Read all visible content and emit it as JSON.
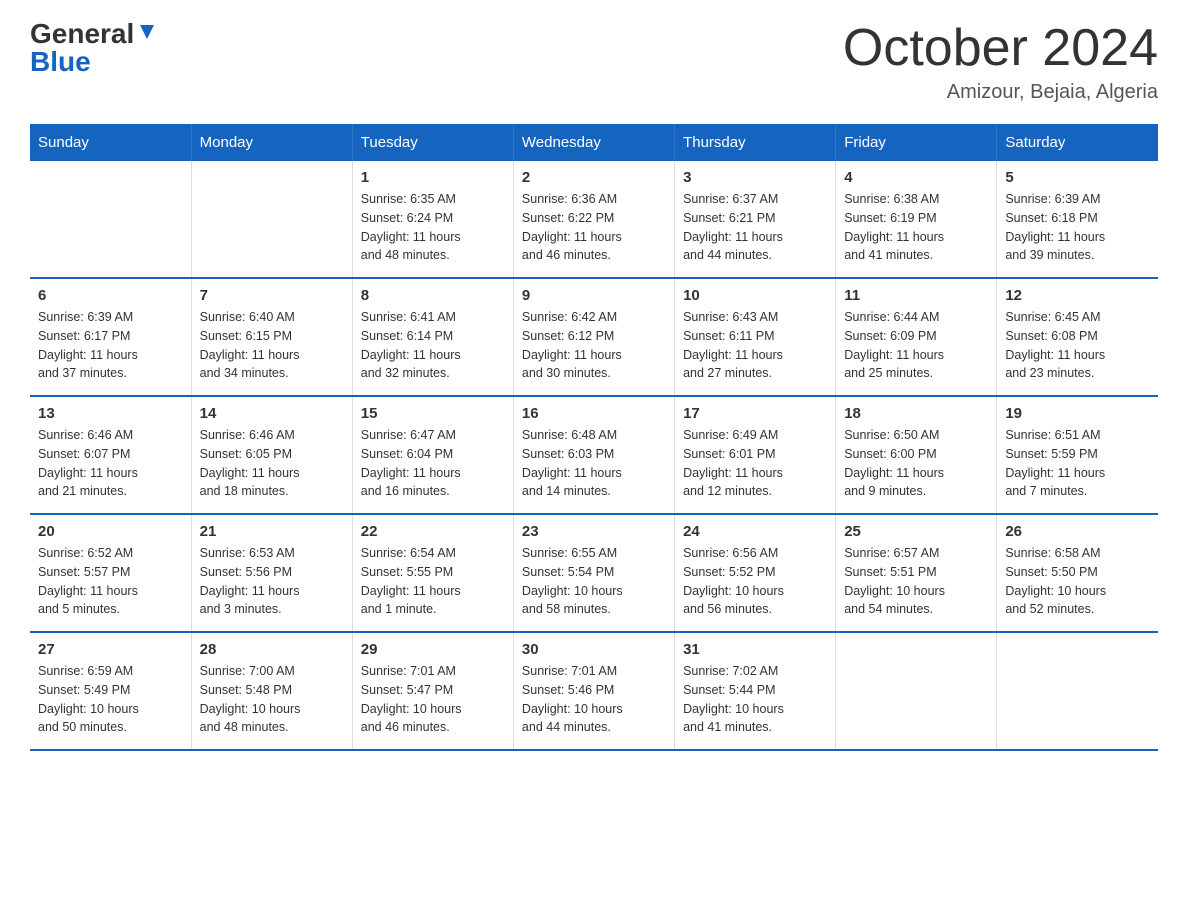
{
  "logo": {
    "general": "General",
    "blue": "Blue"
  },
  "title": "October 2024",
  "subtitle": "Amizour, Bejaia, Algeria",
  "days_of_week": [
    "Sunday",
    "Monday",
    "Tuesday",
    "Wednesday",
    "Thursday",
    "Friday",
    "Saturday"
  ],
  "weeks": [
    [
      {
        "day": "",
        "info": ""
      },
      {
        "day": "",
        "info": ""
      },
      {
        "day": "1",
        "info": "Sunrise: 6:35 AM\nSunset: 6:24 PM\nDaylight: 11 hours\nand 48 minutes."
      },
      {
        "day": "2",
        "info": "Sunrise: 6:36 AM\nSunset: 6:22 PM\nDaylight: 11 hours\nand 46 minutes."
      },
      {
        "day": "3",
        "info": "Sunrise: 6:37 AM\nSunset: 6:21 PM\nDaylight: 11 hours\nand 44 minutes."
      },
      {
        "day": "4",
        "info": "Sunrise: 6:38 AM\nSunset: 6:19 PM\nDaylight: 11 hours\nand 41 minutes."
      },
      {
        "day": "5",
        "info": "Sunrise: 6:39 AM\nSunset: 6:18 PM\nDaylight: 11 hours\nand 39 minutes."
      }
    ],
    [
      {
        "day": "6",
        "info": "Sunrise: 6:39 AM\nSunset: 6:17 PM\nDaylight: 11 hours\nand 37 minutes."
      },
      {
        "day": "7",
        "info": "Sunrise: 6:40 AM\nSunset: 6:15 PM\nDaylight: 11 hours\nand 34 minutes."
      },
      {
        "day": "8",
        "info": "Sunrise: 6:41 AM\nSunset: 6:14 PM\nDaylight: 11 hours\nand 32 minutes."
      },
      {
        "day": "9",
        "info": "Sunrise: 6:42 AM\nSunset: 6:12 PM\nDaylight: 11 hours\nand 30 minutes."
      },
      {
        "day": "10",
        "info": "Sunrise: 6:43 AM\nSunset: 6:11 PM\nDaylight: 11 hours\nand 27 minutes."
      },
      {
        "day": "11",
        "info": "Sunrise: 6:44 AM\nSunset: 6:09 PM\nDaylight: 11 hours\nand 25 minutes."
      },
      {
        "day": "12",
        "info": "Sunrise: 6:45 AM\nSunset: 6:08 PM\nDaylight: 11 hours\nand 23 minutes."
      }
    ],
    [
      {
        "day": "13",
        "info": "Sunrise: 6:46 AM\nSunset: 6:07 PM\nDaylight: 11 hours\nand 21 minutes."
      },
      {
        "day": "14",
        "info": "Sunrise: 6:46 AM\nSunset: 6:05 PM\nDaylight: 11 hours\nand 18 minutes."
      },
      {
        "day": "15",
        "info": "Sunrise: 6:47 AM\nSunset: 6:04 PM\nDaylight: 11 hours\nand 16 minutes."
      },
      {
        "day": "16",
        "info": "Sunrise: 6:48 AM\nSunset: 6:03 PM\nDaylight: 11 hours\nand 14 minutes."
      },
      {
        "day": "17",
        "info": "Sunrise: 6:49 AM\nSunset: 6:01 PM\nDaylight: 11 hours\nand 12 minutes."
      },
      {
        "day": "18",
        "info": "Sunrise: 6:50 AM\nSunset: 6:00 PM\nDaylight: 11 hours\nand 9 minutes."
      },
      {
        "day": "19",
        "info": "Sunrise: 6:51 AM\nSunset: 5:59 PM\nDaylight: 11 hours\nand 7 minutes."
      }
    ],
    [
      {
        "day": "20",
        "info": "Sunrise: 6:52 AM\nSunset: 5:57 PM\nDaylight: 11 hours\nand 5 minutes."
      },
      {
        "day": "21",
        "info": "Sunrise: 6:53 AM\nSunset: 5:56 PM\nDaylight: 11 hours\nand 3 minutes."
      },
      {
        "day": "22",
        "info": "Sunrise: 6:54 AM\nSunset: 5:55 PM\nDaylight: 11 hours\nand 1 minute."
      },
      {
        "day": "23",
        "info": "Sunrise: 6:55 AM\nSunset: 5:54 PM\nDaylight: 10 hours\nand 58 minutes."
      },
      {
        "day": "24",
        "info": "Sunrise: 6:56 AM\nSunset: 5:52 PM\nDaylight: 10 hours\nand 56 minutes."
      },
      {
        "day": "25",
        "info": "Sunrise: 6:57 AM\nSunset: 5:51 PM\nDaylight: 10 hours\nand 54 minutes."
      },
      {
        "day": "26",
        "info": "Sunrise: 6:58 AM\nSunset: 5:50 PM\nDaylight: 10 hours\nand 52 minutes."
      }
    ],
    [
      {
        "day": "27",
        "info": "Sunrise: 6:59 AM\nSunset: 5:49 PM\nDaylight: 10 hours\nand 50 minutes."
      },
      {
        "day": "28",
        "info": "Sunrise: 7:00 AM\nSunset: 5:48 PM\nDaylight: 10 hours\nand 48 minutes."
      },
      {
        "day": "29",
        "info": "Sunrise: 7:01 AM\nSunset: 5:47 PM\nDaylight: 10 hours\nand 46 minutes."
      },
      {
        "day": "30",
        "info": "Sunrise: 7:01 AM\nSunset: 5:46 PM\nDaylight: 10 hours\nand 44 minutes."
      },
      {
        "day": "31",
        "info": "Sunrise: 7:02 AM\nSunset: 5:44 PM\nDaylight: 10 hours\nand 41 minutes."
      },
      {
        "day": "",
        "info": ""
      },
      {
        "day": "",
        "info": ""
      }
    ]
  ]
}
